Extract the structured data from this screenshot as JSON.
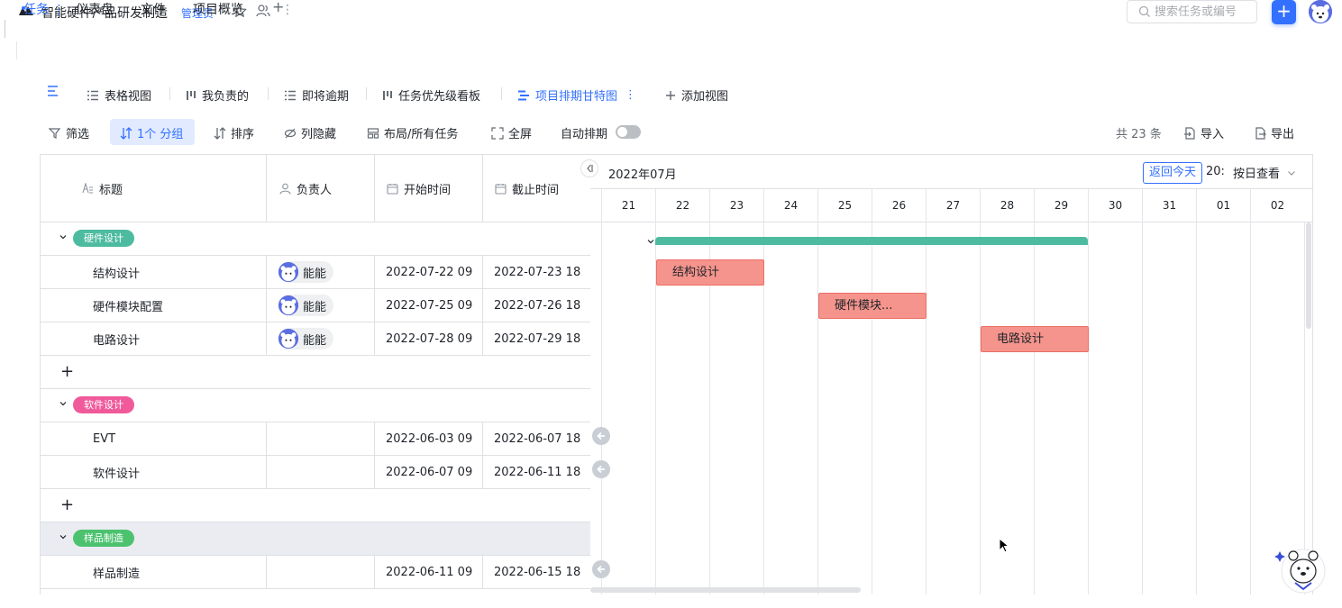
{
  "project": {
    "title": "智能硬件产品研发制造",
    "role": "管理员"
  },
  "search": {
    "placeholder": "搜索任务或编号"
  },
  "add_button": "+",
  "main_tabs": [
    {
      "label": "任务"
    },
    {
      "label": "仪表盘"
    },
    {
      "label": "文件"
    },
    {
      "label": "项目概览"
    }
  ],
  "main_tabs_add": "+",
  "view_tabs": [
    {
      "label": "表格视图"
    },
    {
      "label": "我负责的"
    },
    {
      "label": "即将逾期"
    },
    {
      "label": "任务优先级看板"
    },
    {
      "label": "项目排期甘特图",
      "active": true
    }
  ],
  "add_view_label": "添加视图",
  "toolbar": {
    "filter": "筛选",
    "group": "1个 分组",
    "sort": "排序",
    "hide_columns": "列隐藏",
    "layout": "布局/所有任务",
    "fullscreen": "全屏",
    "auto_schedule": "自动排期",
    "auto_schedule_on": false,
    "count": "共 23 条",
    "import": "导入",
    "export": "导出"
  },
  "columns": {
    "title": "标题",
    "assignee": "负责人",
    "start": "开始时间",
    "end": "截止时间"
  },
  "groups": [
    {
      "name": "硬件设计",
      "color": "#4dbba0",
      "tasks": [
        {
          "title": "结构设计",
          "assignee": "能能",
          "start": "2022-07-22 09",
          "end": "2022-07-23 18",
          "bar": "结构设计"
        },
        {
          "title": "硬件模块配置",
          "assignee": "能能",
          "start": "2022-07-25 09",
          "end": "2022-07-26 18",
          "bar": "硬件模块..."
        },
        {
          "title": "电路设计",
          "assignee": "能能",
          "start": "2022-07-28 09",
          "end": "2022-07-29 18",
          "bar": "电路设计"
        }
      ]
    },
    {
      "name": "软件设计",
      "color": "#f05a9b",
      "tasks": [
        {
          "title": "EVT",
          "assignee": "",
          "start": "2022-06-03 09",
          "end": "2022-06-07 18"
        },
        {
          "title": "软件设计",
          "assignee": "",
          "start": "2022-06-07 09",
          "end": "2022-06-11 18"
        }
      ]
    },
    {
      "name": "样品制造",
      "color": "#4cc26f",
      "tasks": [
        {
          "title": "样品制造",
          "assignee": "",
          "start": "2022-06-11 09",
          "end": "2022-06-15 18"
        }
      ]
    }
  ],
  "add_row": "+",
  "gantt": {
    "month_label": "2022年07月",
    "today_button": "返回今天",
    "year_stub": "20:",
    "zoom_label": "按日查看",
    "days": [
      "21",
      "22",
      "23",
      "24",
      "25",
      "26",
      "27",
      "28",
      "29",
      "30",
      "31",
      "01",
      "02"
    ]
  },
  "colors": {
    "accent": "#3370ff",
    "bar_fill": "#f5948c",
    "summary_bar": "#4dbba0"
  }
}
